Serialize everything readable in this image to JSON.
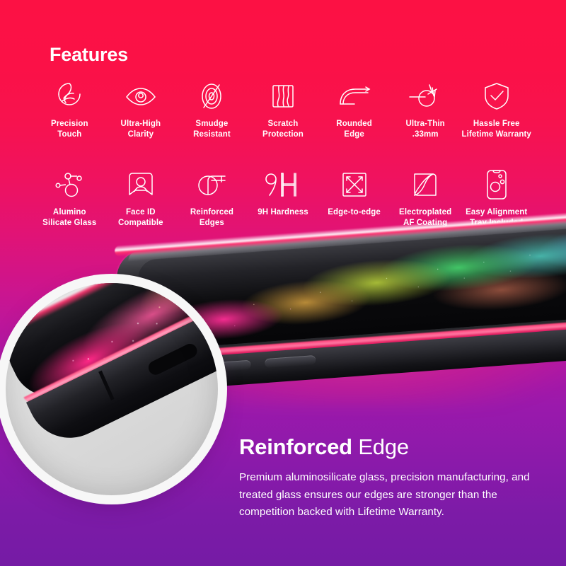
{
  "theme": {
    "gradient_top": "#FC1144",
    "gradient_mid": "#C3158F",
    "gradient_bottom": "#751BA5",
    "text_color": "#FFFFFF",
    "magnifier_ring": "#F7F7F7"
  },
  "features": {
    "heading": "Features",
    "row1": [
      {
        "icon": "precision-touch-icon",
        "label": "Precision\nTouch"
      },
      {
        "icon": "eye-clarity-icon",
        "label": "Ultra-High\nClarity"
      },
      {
        "icon": "smudge-resistant-icon",
        "label": "Smudge\nResistant"
      },
      {
        "icon": "scratch-protection-icon",
        "label": "Scratch\nProtection"
      },
      {
        "icon": "rounded-edge-icon",
        "label": "Rounded\nEdge"
      },
      {
        "icon": "ultra-thin-icon",
        "label": "Ultra-Thin\n.33mm"
      },
      {
        "icon": "shield-check-icon",
        "label": "Hassle Free\nLifetime Warranty"
      }
    ],
    "row2": [
      {
        "icon": "molecule-icon",
        "label": "Alumino\nSilicate Glass"
      },
      {
        "icon": "face-id-icon",
        "label": "Face ID\nCompatible"
      },
      {
        "icon": "reinforced-edges-icon",
        "label": "Reinforced\nEdges"
      },
      {
        "icon": "9h-hardness-icon",
        "label": "9H Hardness"
      },
      {
        "icon": "edge-to-edge-icon",
        "label": "Edge-to-edge"
      },
      {
        "icon": "electroplated-coating-icon",
        "label": "Electroplated\nAF Coating"
      },
      {
        "icon": "alignment-tray-icon",
        "label": "Easy Alignment\nTray Included"
      }
    ]
  },
  "product_shot": {
    "description": "screen-protector-phone-angled-photo",
    "magnifier": "magnified-phone-corner-edge-detail"
  },
  "copy": {
    "title_bold": "Reinforced",
    "title_light": " Edge",
    "body": "Premium aluminosilicate glass, precision manufacturing, and treated glass ensures our edges are stronger than the competition backed with Lifetime Warranty."
  }
}
